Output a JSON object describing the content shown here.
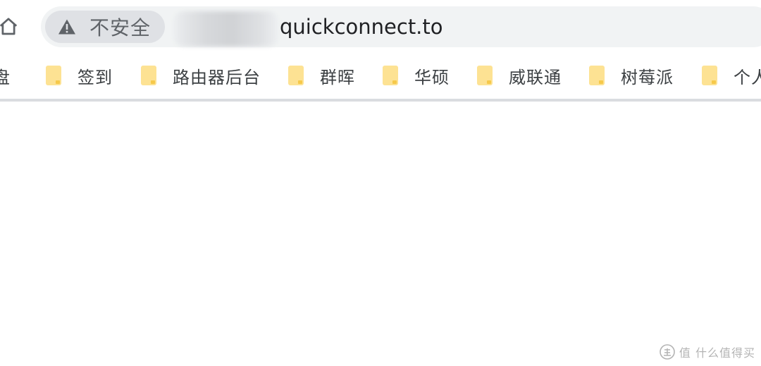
{
  "toolbar": {
    "home_icon": "home-icon"
  },
  "omnibox": {
    "security_icon": "warning-triangle-icon",
    "security_label": "不安全",
    "url_host_suffix": "quickconnect.to"
  },
  "bookmarks": {
    "partial_left_label": "盘",
    "items": [
      {
        "label": "签到"
      },
      {
        "label": "路由器后台"
      },
      {
        "label": "群晖"
      },
      {
        "label": "华硕"
      },
      {
        "label": "威联通"
      },
      {
        "label": "树莓派"
      },
      {
        "label": "个人"
      }
    ],
    "folder_icon": "folder-icon",
    "folder_color": "#fde293"
  },
  "watermark": {
    "text": "值 什么值得买"
  },
  "colors": {
    "omnibox_bg": "#f1f3f4",
    "chip_bg": "#dfe1e5",
    "divider": "#dadce0"
  }
}
